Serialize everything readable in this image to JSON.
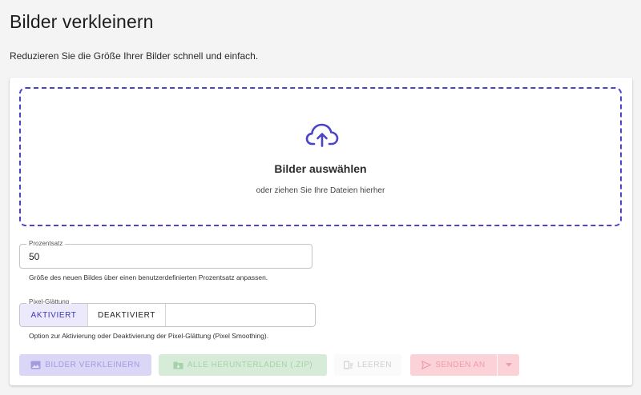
{
  "page": {
    "title": "Bilder verkleinern",
    "subtitle": "Reduzieren Sie die Größe Ihrer Bilder schnell und einfach."
  },
  "dropzone": {
    "icon": "cloud-upload-icon",
    "title": "Bilder auswählen",
    "subtitle": "oder ziehen Sie Ihre Dateien hierher"
  },
  "percent_field": {
    "label": "Prozentsatz",
    "value": "50",
    "help": "Größe des neuen Bildes über einen benutzerdefinierten Prozentsatz anpassen."
  },
  "smoothing": {
    "label": "Pixel-Glättung",
    "options": [
      "AKTIVIERT",
      "DEAKTIVIERT"
    ],
    "selected": "AKTIVIERT",
    "help": "Option zur Aktivierung oder Deaktivierung der Pixel-Glättung (Pixel Smoothing)."
  },
  "actions": {
    "resize": {
      "label": "BILDER VERKLEINERN",
      "icon": "image-icon"
    },
    "download_all": {
      "label": "ALLE HERUNTERLADEN (.ZIP)",
      "icon": "folder-download-icon"
    },
    "clear": {
      "label": "LEEREN",
      "icon": "clear-icon"
    },
    "send_to": {
      "label": "SENDEN AN",
      "icon": "send-icon"
    },
    "send_menu": {
      "icon": "caret-down-icon"
    }
  },
  "colors": {
    "accent": "#4b44c9",
    "background": "#f4f4f4"
  }
}
